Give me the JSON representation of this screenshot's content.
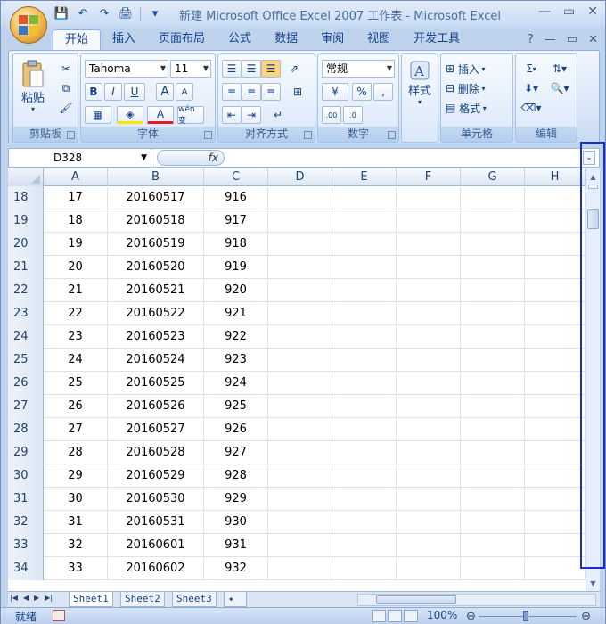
{
  "window": {
    "title": "新建 Microsoft Office Excel 2007 工作表 - Microsoft Excel",
    "controls": {
      "minimize": "—",
      "restore": "▭",
      "close": "✕"
    }
  },
  "quick_access": {
    "save": "💾",
    "undo": "↶",
    "redo": "↷",
    "print_preview": "🖨",
    "customize": "▾"
  },
  "ribbon_tabs": [
    "开始",
    "插入",
    "页面布局",
    "公式",
    "数据",
    "审阅",
    "视图",
    "开发工具"
  ],
  "ribbon_tab_active": "开始",
  "ribbon_right": {
    "help": "?",
    "minimize": "—",
    "restore": "▭",
    "close": "✕"
  },
  "groups": {
    "clipboard": {
      "label": "剪贴板",
      "paste": "粘贴"
    },
    "font": {
      "label": "字体",
      "font_name": "Tahoma",
      "font_size": "11",
      "bold": "B",
      "italic": "I",
      "underline": "U",
      "grow": "A",
      "shrink": "A",
      "wen": "wén 变"
    },
    "alignment": {
      "label": "对齐方式"
    },
    "number": {
      "label": "数字",
      "format": "常规",
      "percent": "%",
      "comma": ","
    },
    "styles": {
      "label": "样式"
    },
    "cells": {
      "label": "单元格",
      "insert": "插入",
      "delete": "删除",
      "format": "格式"
    },
    "editing": {
      "label": "编辑",
      "sum": "Σ"
    }
  },
  "formula_bar": {
    "name_box": "D328",
    "fx": "fx",
    "expand": "⌄"
  },
  "columns": [
    "A",
    "B",
    "C",
    "D",
    "E",
    "F",
    "G",
    "H"
  ],
  "rows": [
    {
      "num": "18",
      "a": "17",
      "b": "20160517",
      "c": "916"
    },
    {
      "num": "19",
      "a": "18",
      "b": "20160518",
      "c": "917"
    },
    {
      "num": "20",
      "a": "19",
      "b": "20160519",
      "c": "918"
    },
    {
      "num": "21",
      "a": "20",
      "b": "20160520",
      "c": "919"
    },
    {
      "num": "22",
      "a": "21",
      "b": "20160521",
      "c": "920"
    },
    {
      "num": "23",
      "a": "22",
      "b": "20160522",
      "c": "921"
    },
    {
      "num": "24",
      "a": "23",
      "b": "20160523",
      "c": "922"
    },
    {
      "num": "25",
      "a": "24",
      "b": "20160524",
      "c": "923"
    },
    {
      "num": "26",
      "a": "25",
      "b": "20160525",
      "c": "924"
    },
    {
      "num": "27",
      "a": "26",
      "b": "20160526",
      "c": "925"
    },
    {
      "num": "28",
      "a": "27",
      "b": "20160527",
      "c": "926"
    },
    {
      "num": "29",
      "a": "28",
      "b": "20160528",
      "c": "927"
    },
    {
      "num": "30",
      "a": "29",
      "b": "20160529",
      "c": "928"
    },
    {
      "num": "31",
      "a": "30",
      "b": "20160530",
      "c": "929"
    },
    {
      "num": "32",
      "a": "31",
      "b": "20160531",
      "c": "930"
    },
    {
      "num": "33",
      "a": "32",
      "b": "20160601",
      "c": "931"
    },
    {
      "num": "34",
      "a": "33",
      "b": "20160602",
      "c": "932"
    }
  ],
  "sheets": [
    "Sheet1",
    "Sheet2",
    "Sheet3"
  ],
  "active_sheet": "Sheet1",
  "status": {
    "ready": "就绪",
    "zoom": "100%"
  },
  "colors": {
    "highlight_box": "#1a2ecf",
    "ribbon_bg": "#d6e5f7"
  }
}
